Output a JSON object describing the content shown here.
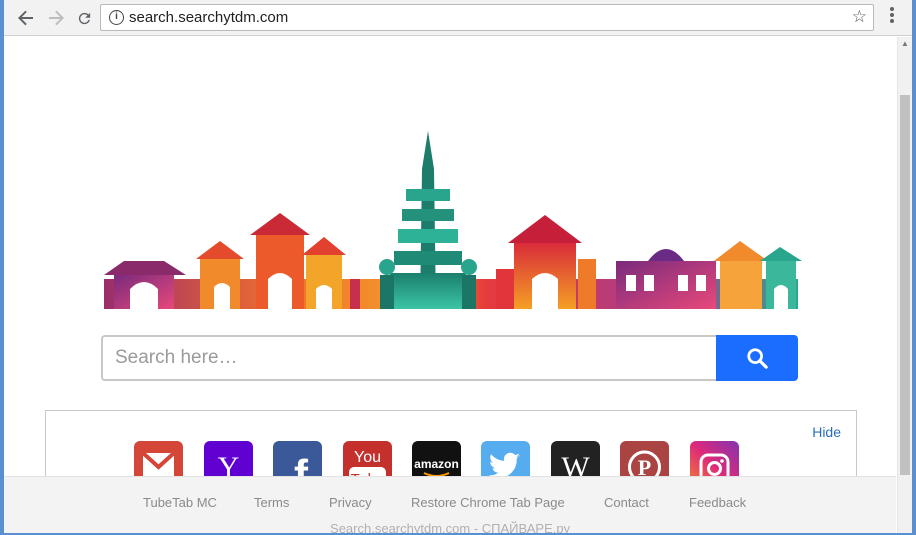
{
  "browser": {
    "url": "search.searchytdm.com",
    "info_icon": "info-icon",
    "bookmark_icon": "star-icon",
    "menu_icon": "kebab-menu-icon"
  },
  "search": {
    "placeholder": "Search here…",
    "button_icon": "search-icon",
    "button_color": "#1a6dff"
  },
  "shortcuts": {
    "hide_label": "Hide",
    "items": [
      {
        "name": "gmail",
        "label": "M",
        "color": "#d44638"
      },
      {
        "name": "yahoo",
        "label": "Y",
        "color": "#6001d2"
      },
      {
        "name": "facebook",
        "label": "f",
        "color": "#3b5998"
      },
      {
        "name": "youtube",
        "label": "You Tube",
        "color": "#c4302b"
      },
      {
        "name": "amazon",
        "label": "amazon",
        "color": "#111111"
      },
      {
        "name": "twitter",
        "label": "twitter",
        "color": "#55acee"
      },
      {
        "name": "wikipedia",
        "label": "W",
        "color": "#222222"
      },
      {
        "name": "pinterest",
        "label": "P",
        "color": "#bd081c"
      },
      {
        "name": "instagram",
        "label": "instagram",
        "color": "#c13584"
      }
    ]
  },
  "footer": {
    "links": [
      "TubeTab MC",
      "Terms",
      "Privacy",
      "Restore Chrome Tab Page",
      "Contact",
      "Feedback"
    ],
    "watermark": "Search.searchytdm.com - СПАЙВАРЕ.ру"
  }
}
